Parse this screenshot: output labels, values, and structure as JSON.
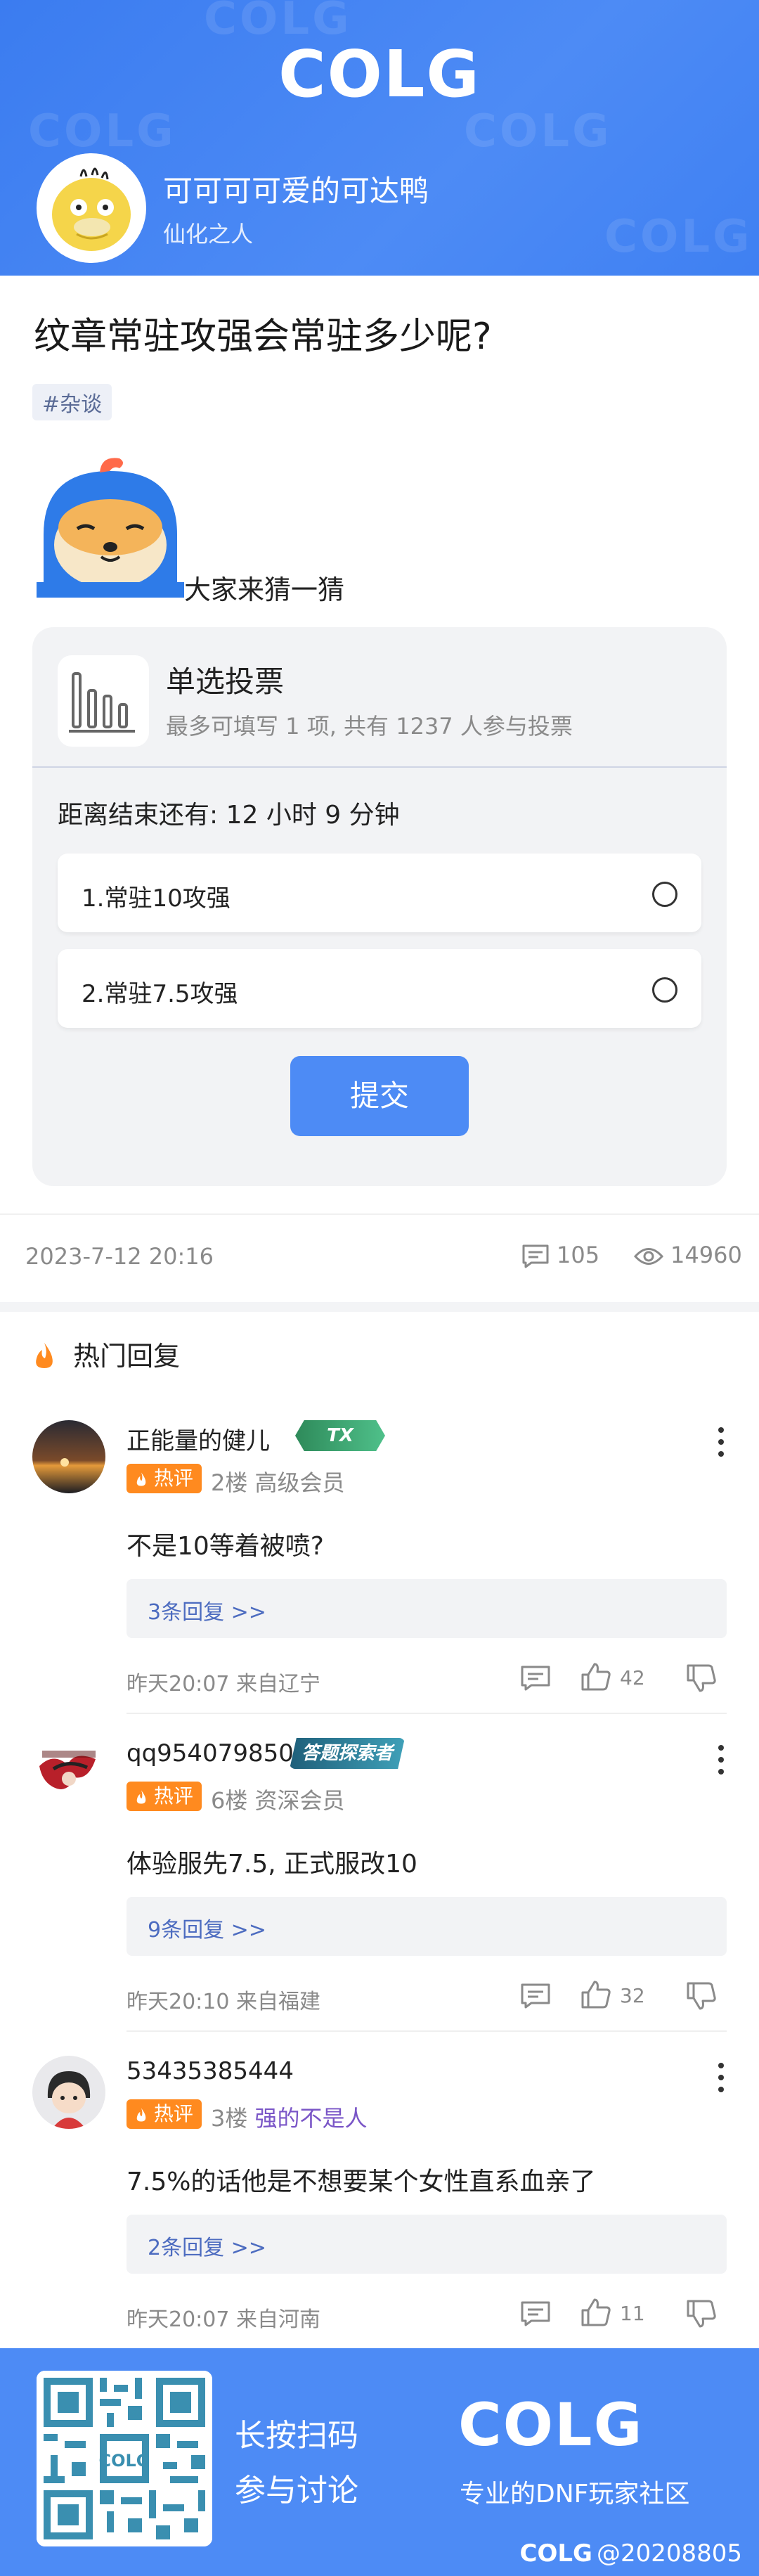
{
  "header": {
    "logo_text": "COLG",
    "username": "可可可可爱的可达鸭",
    "user_title": "仙化之人"
  },
  "post": {
    "title": "纹章常驻攻强会常驻多少呢?",
    "tag": "#杂谈",
    "body": "大家来猜一猜"
  },
  "vote": {
    "type": "单选投票",
    "subtitle": "最多可填写 1 项, 共有 1237 人参与投票",
    "remaining": "距离结束还有: 12 小时 9 分钟",
    "options": [
      {
        "label": "1.常驻10攻强"
      },
      {
        "label": "2.常驻7.5攻强"
      }
    ],
    "submit_label": "提交"
  },
  "meta": {
    "date": "2023-7-12 20:16",
    "comments": "105",
    "views": "14960"
  },
  "hot_replies": {
    "heading": "热门回复",
    "hot_label": "热评",
    "items": [
      {
        "name": "正能量的健儿",
        "badge": "TX",
        "floor": "2楼",
        "level": "高级会员",
        "text": "不是10等着被喷?",
        "sub_replies": "3条回复 >>",
        "time": "昨天20:07 来自辽宁",
        "likes": "42"
      },
      {
        "name": "qq954079850",
        "badge": "答题探索者",
        "floor": "6楼",
        "level": "资深会员",
        "text": "体验服先7.5, 正式服改10",
        "sub_replies": "9条回复 >>",
        "time": "昨天20:10 来自福建",
        "likes": "32"
      },
      {
        "name": "53435385444",
        "badge": "",
        "floor": "3楼",
        "level": "强的不是人",
        "text": "7.5%的话他是不想要某个女性直系血亲了",
        "sub_replies": "2条回复 >>",
        "time": "昨天20:07 来自河南",
        "likes": "11"
      }
    ]
  },
  "footer": {
    "line1": "长按扫码",
    "line2": "参与讨论",
    "logo_text": "COLG",
    "slogan": "专业的DNF玩家社区",
    "id_logo": "COLG",
    "id_text": "@20208805"
  },
  "colors": {
    "brand_blue": "#4d8bf5",
    "hot_orange": "#ff8a1f",
    "link_blue": "#4d6cc0",
    "special_purple": "#7a56c7"
  }
}
